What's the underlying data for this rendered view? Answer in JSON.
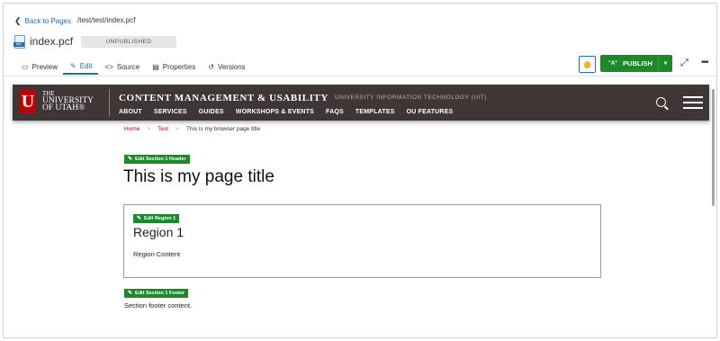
{
  "topbar": {
    "back_label": "Back to Pages",
    "path": "/test/test/index.pcf",
    "filename": "index.pcf",
    "file_tag": "PCF",
    "status": "UNPUBLISHED"
  },
  "tabs": [
    {
      "label": "Preview",
      "icon": "monitor-icon"
    },
    {
      "label": "Edit",
      "icon": "pencil-icon",
      "active": true
    },
    {
      "label": "Source",
      "icon": "code-icon"
    },
    {
      "label": "Properties",
      "icon": "properties-icon"
    },
    {
      "label": "Versions",
      "icon": "history-icon"
    }
  ],
  "actions": {
    "publish_label": "PUBLISH",
    "publish_prefix": "\"A\""
  },
  "site": {
    "logo_u": "U",
    "logo_line1": "THE",
    "logo_line2": "UNIVERSITY",
    "logo_line3": "OF UTAH®",
    "title": "CONTENT MANAGEMENT & USABILITY",
    "subtitle": "UNIVERSITY INFORMATION TECHNOLOGY (UIT)",
    "nav": [
      "ABOUT",
      "SERVICES",
      "GUIDES",
      "WORKSHOPS & EVENTS",
      "FAQS",
      "TEMPLATES",
      "OU FEATURES"
    ]
  },
  "breadcrumb": {
    "home": "Home",
    "test": "Test",
    "current": "This is my browser page title",
    "separator": ">"
  },
  "content": {
    "edit_header_label": "Edit Section 1 Header",
    "page_title": "This is my page title",
    "edit_region_label": "Edit Region 1",
    "region_title": "Region 1",
    "region_content": "Region Content",
    "edit_footer_label": "Edit Section 1 Footer",
    "footer_text": "Section footer content."
  },
  "colors": {
    "accent_blue": "#1a6fb0",
    "publish_green": "#1c8a2a",
    "utah_red": "#be0000",
    "header_dark": "#3e3736",
    "bulb_yellow": "#f2b51c"
  }
}
